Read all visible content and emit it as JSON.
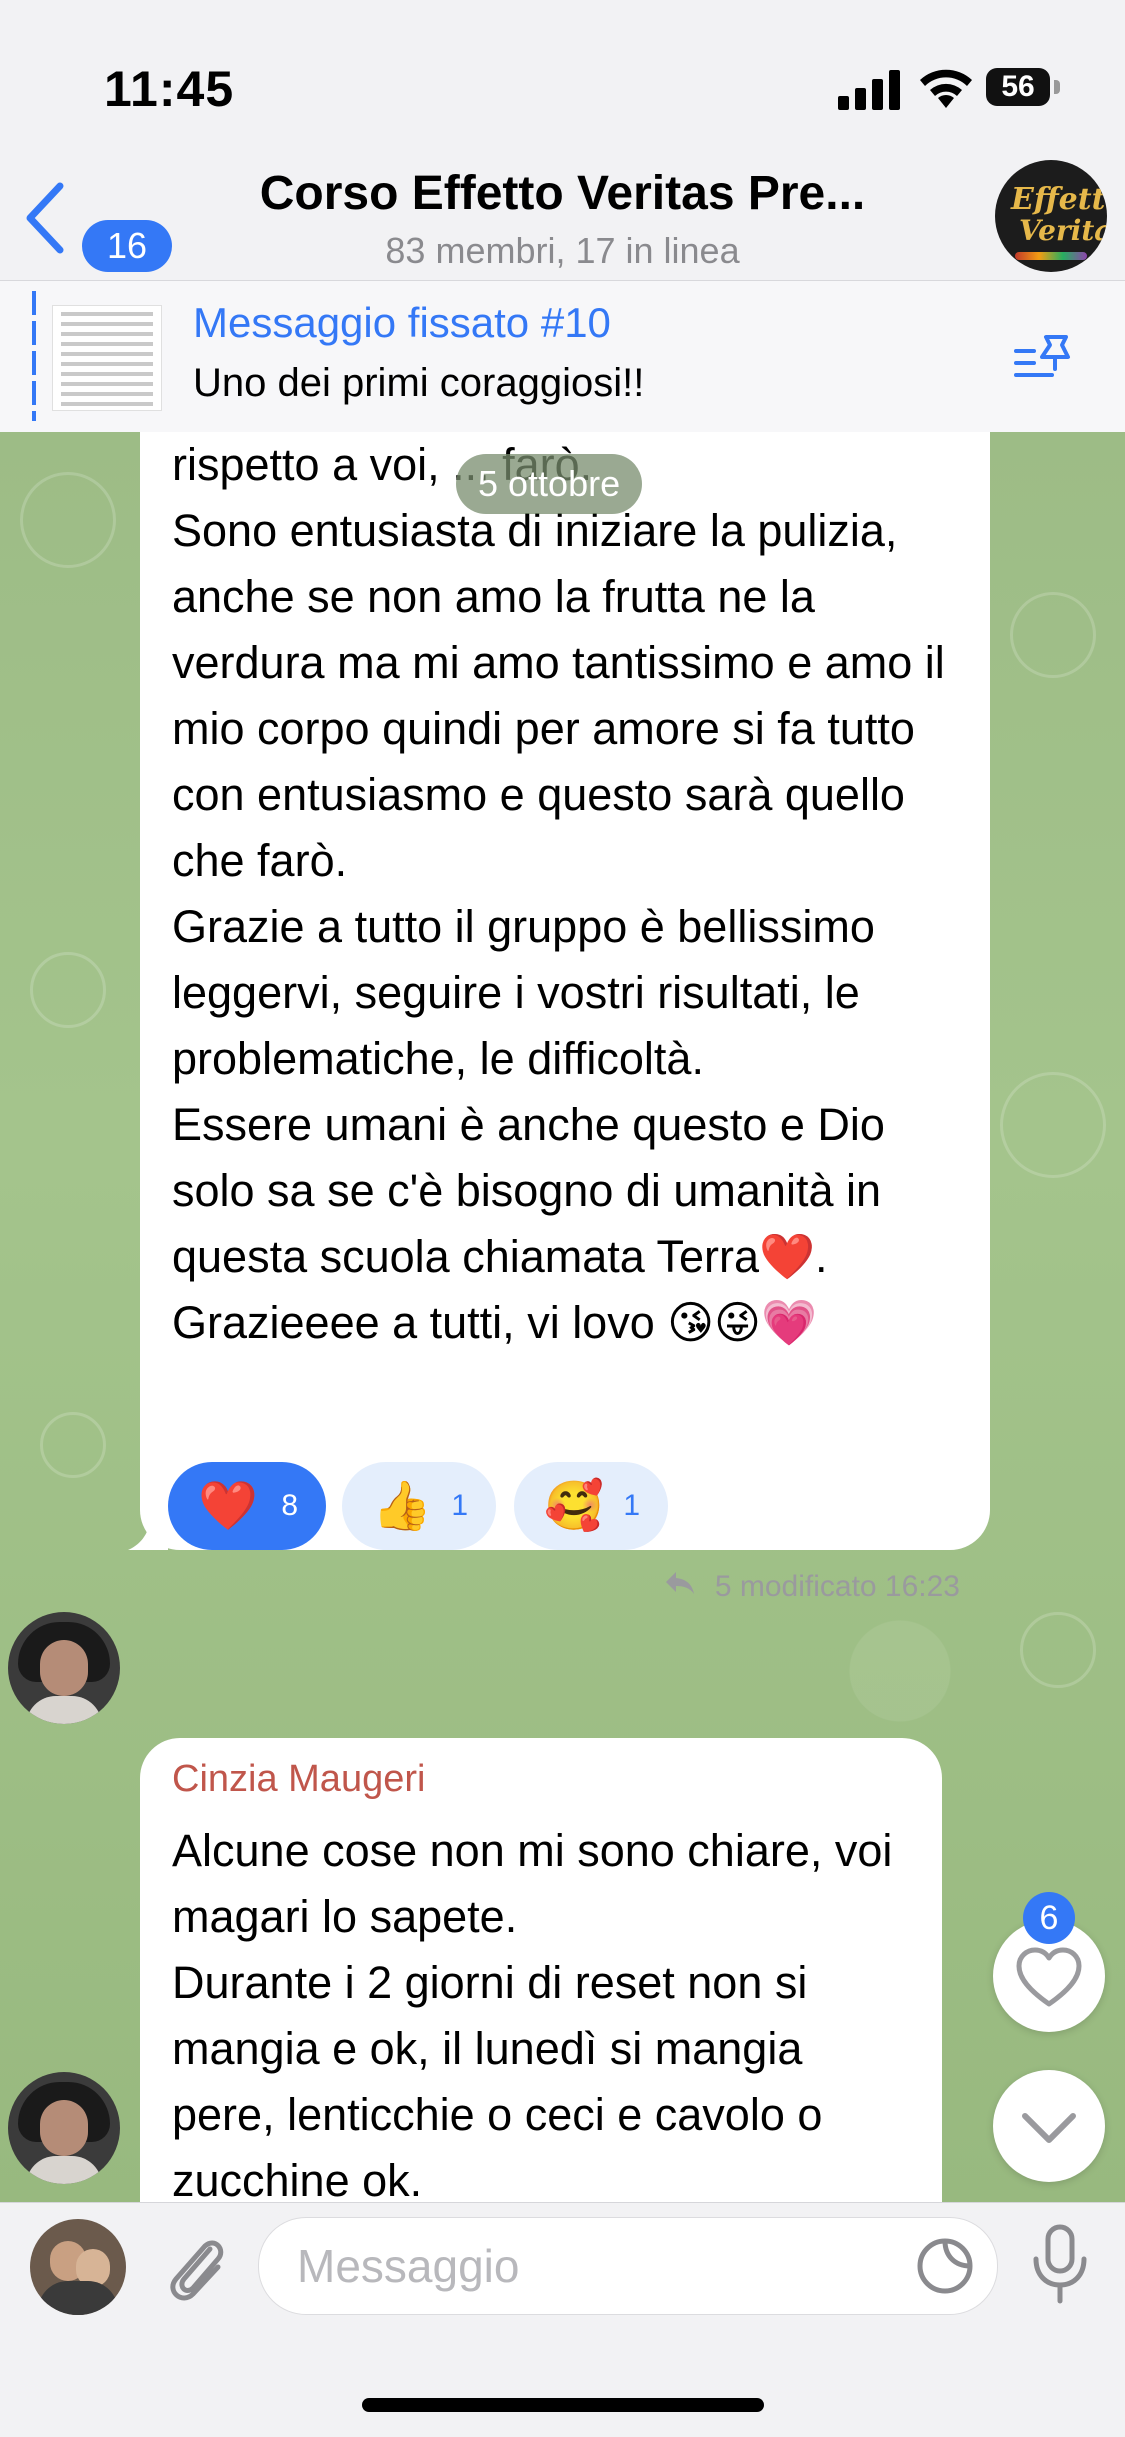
{
  "status_bar": {
    "time": "11:45",
    "battery": "56"
  },
  "header": {
    "back_badge": "16",
    "title": "Corso Effetto Veritas Pre...",
    "subtitle": "83 membri, 17 in linea",
    "group_avatar_line1": "Effetto",
    "group_avatar_line2": "Veritas"
  },
  "pinned": {
    "title": "Messaggio fissato #10",
    "text": "Uno dei primi coraggiosi!!"
  },
  "chat": {
    "date_pill": "5 ottobre",
    "message1": {
      "text": "rispetto a voi, ... farò.\nSono entusiasta di iniziare la pulizia, anche se non amo la frutta ne la verdura ma mi amo tantissimo e amo il mio corpo quindi per amore si fa tutto con entusiasmo e questo sarà quello che farò.\nGrazie a tutto il gruppo è bellissimo leggervi, seguire i vostri risultati, le  problematiche, le difficoltà.\nEssere umani è anche questo e Dio solo sa se c'è bisogno di umanità in questa scuola chiamata Terra❤️.\nGrazieeee a tutti, vi lovo 😘😜💗",
      "reactions": [
        {
          "emoji": "❤️",
          "count": "8",
          "selected": true
        },
        {
          "emoji": "👍",
          "count": "1",
          "selected": false
        },
        {
          "emoji": "🥰",
          "count": "1",
          "selected": false
        }
      ],
      "replies": "5",
      "meta": "modificato 16:23"
    },
    "message2": {
      "sender": "Cinzia Maugeri",
      "text": "Alcune cose non mi sono chiare, voi magari lo sapete.\nDurante i 2 giorni di reset non si mangia e ok, il lunedì si mangia pere, lenticchie o ceci e cavolo o zucchine ok."
    },
    "reactions_fab_badge": "6"
  },
  "input": {
    "placeholder": "Messaggio"
  },
  "colors": {
    "accent": "#3478f6",
    "sender_name": "#c0564b",
    "chat_bg": "#a4c48c"
  }
}
